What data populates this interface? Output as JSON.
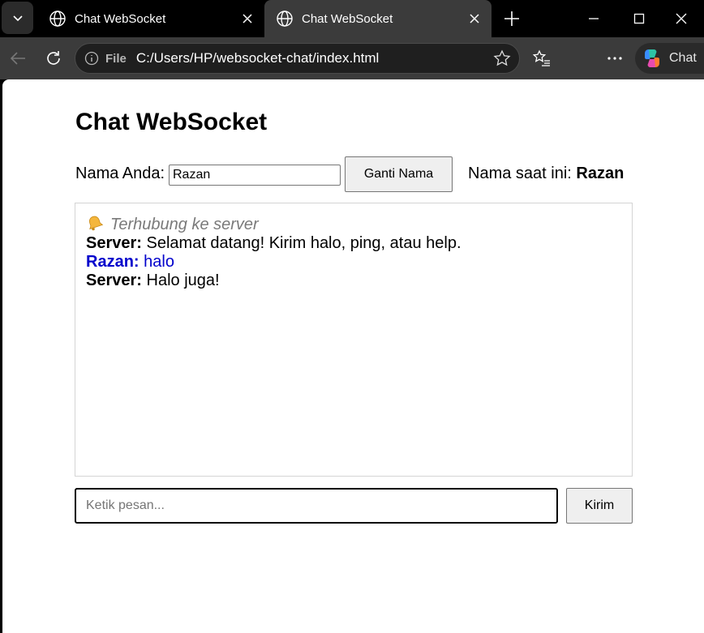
{
  "browser": {
    "tabs": [
      {
        "title": "Chat WebSocket",
        "active": false
      },
      {
        "title": "Chat WebSocket",
        "active": true
      }
    ],
    "address": {
      "scheme_label": "File",
      "url": "C:/Users/HP/websocket-chat/index.html"
    },
    "copilot_label": "Chat",
    "icons": [
      "tab-actions-icon",
      "globe-icon",
      "close-icon",
      "plus-icon",
      "minimize-icon",
      "maximize-icon",
      "window-close-icon",
      "back-icon",
      "reload-icon",
      "info-icon",
      "favorite-star-icon",
      "favorites-icon",
      "profile-icon",
      "more-icon",
      "copilot-icon"
    ]
  },
  "page": {
    "title": "Chat WebSocket",
    "name_label": "Nama Anda:",
    "name_value": "Razan",
    "rename_button": "Ganti Nama",
    "current_label": "Nama saat ini:",
    "current_name": "Razan",
    "messages": [
      {
        "type": "system",
        "icon": "bell-icon",
        "text": "Terhubung ke server"
      },
      {
        "type": "server",
        "sender": "Server:",
        "text": "Selamat datang! Kirim halo, ping, atau help."
      },
      {
        "type": "self",
        "sender": "Razan:",
        "text": "halo"
      },
      {
        "type": "server",
        "sender": "Server:",
        "text": "Halo juga!"
      }
    ],
    "input_placeholder": "Ketik pesan...",
    "send_button": "Kirim"
  },
  "colors": {
    "self_message": "#0000cc",
    "system_message": "#7a7a7a",
    "tab_active": "#3b3b3b"
  }
}
